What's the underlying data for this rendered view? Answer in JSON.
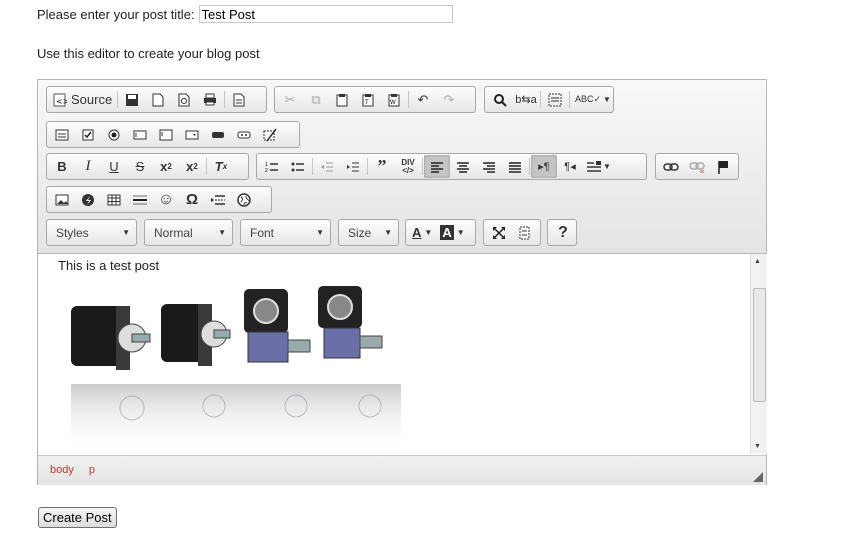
{
  "form": {
    "title_label": "Please enter your post title:",
    "title_value": "Test Post",
    "editor_hint": "Use this editor to create your blog post",
    "submit_label": "Create Post"
  },
  "toolbar": {
    "source_label": "Source",
    "styles_label": "Styles",
    "format_label": "Normal",
    "font_label": "Font",
    "size_label": "Size",
    "help_label": "?"
  },
  "content": {
    "text": "This is a test post",
    "image_description_icon": "gearboxes-image"
  },
  "elements_path": [
    "body",
    "p"
  ],
  "colors": {
    "path_text": "#c0392b",
    "toolbar_border": "#a8a8a8"
  }
}
